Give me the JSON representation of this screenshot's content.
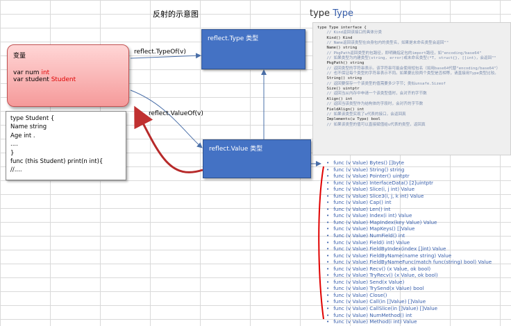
{
  "title": "反射的示意图",
  "var_box": {
    "title": "变量",
    "line1_prefix": "var num",
    "line1_type": "int",
    "line2_prefix": "var student",
    "line2_type": "Student"
  },
  "struct_box": {
    "lines": [
      "type  Student {",
      "Name string",
      "Age int .",
      "....",
      "}",
      "func  (this Student)   print(n int){",
      "//...."
    ]
  },
  "type_box": {
    "label": "reflect.Type 类型"
  },
  "value_box": {
    "label": "reflect.Value 类型"
  },
  "arrows": {
    "typeof": "reflect.TypeOf(v)",
    "valueof": "reflect.ValueOf(v)"
  },
  "doc_header": {
    "prefix": "type",
    "name": "Type"
  },
  "code_lines": [
    "type Type interface {",
    "    // Kind返回该接口的具体分类",
    "    Kind() Kind",
    "    // Name返回该类型在自身包内的类型名，如果是未命名类型会返回\"\"",
    "    Name() string",
    "    // PkgPath返回类型的包路径，即明确指定包的import路径，如\"encoding/base64\"",
    "    // 如果类型为内建类型(string, error)或未命名类型(*T, struct{}, []int)，会返回\"\"",
    "    PkgPath() string",
    "    // 返回类型的字符串表示。该字符串可能会使用短包名（如用base64代替\"encoding/base64\"）",
    "    // 也不保证每个类型的字符串表示不同。如果要比较两个类型是否相等，请直接用Type类型比较。",
    "    String() string",
    "    // 返回要保存一个该类型的值需要多少字节；类似unsafe.Sizeof",
    "    Size() uintptr",
    "    // 返回当从内存中申请一个该类型值时，会对齐的字节数",
    "    Align() int",
    "    // 返回当该类型作为结构体的字段时，会对齐的字节数",
    "    FieldAlign() int",
    "    // 如果该类型实现了u代表的接口，会返回真",
    "    Implements(u Type) bool",
    "    // 如果该类型的值可以直接赋值给u代表的类型，返回真"
  ],
  "methods": [
    "func (v Value) Bytes() []byte",
    "func (v Value) String() string",
    "func (v Value) Pointer() uintptr",
    "func (v Value) InterfaceData() [2]uintptr",
    "func (v Value) Slice(i, j int) Value",
    "func (v Value) Slice3(i, j, k int) Value",
    "func (v Value) Cap() int",
    "func (v Value) Len() int",
    "func (v Value) Index(i int) Value",
    "func (v Value) MapIndex(key Value) Value",
    "func (v Value) MapKeys() []Value",
    "func (v Value) NumField() int",
    "func (v Value) Field(i int) Value",
    "func (v Value) FieldByIndex(index []int) Value",
    "func (v Value) FieldByName(name string) Value",
    "func (v Value) FieldByNameFunc(match func(string) bool) Value",
    "func (v Value) Recv() (x Value, ok bool)",
    "func (v Value) TryRecv() (x Value, ok bool)",
    "func (v Value) Send(x Value)",
    "func (v Value) TrySend(x Value) bool",
    "func (v Value) Close()",
    "func (v Value) Call(in []Value) []Value",
    "func (v Value) CallSlice(in []Value) []Value",
    "func (v Value) NumMethod() int",
    "func (v Value) Method(i int) Value"
  ]
}
